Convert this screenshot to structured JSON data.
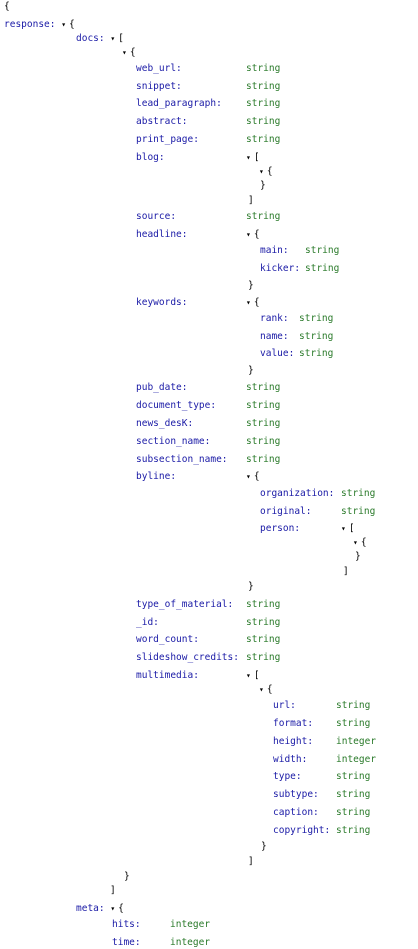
{
  "glyphs": {
    "toggle": "▾",
    "open_brace": "{",
    "close_brace": "}",
    "open_bracket": "[",
    "close_bracket": "]"
  },
  "tree": {
    "response_key": "response:",
    "docs_key": "docs:",
    "web_url_key": "web_url:",
    "snippet_key": "snippet:",
    "lead_paragraph_key": "lead_paragraph:",
    "abstract_key": "abstract:",
    "print_page_key": "print_page:",
    "blog_key": "blog:",
    "source_key": "source:",
    "headline_key": "headline:",
    "main_key": "main:",
    "kicker_key": "kicker:",
    "keywords_key": "keywords:",
    "rank_key": "rank:",
    "name_key": "name:",
    "value_key": "value:",
    "pub_date_key": "pub_date:",
    "document_type_key": "document_type:",
    "news_desk_key": "news_desK:",
    "section_name_key": "section_name:",
    "subsection_name_key": "subsection_name:",
    "byline_key": "byline:",
    "organization_key": "organization:",
    "original_key": "original:",
    "person_key": "person:",
    "type_of_material_key": "type_of_material:",
    "id_key": "_id:",
    "word_count_key": "word_count:",
    "slideshow_credits_key": "slideshow_credits:",
    "multimedia_key": "multimedia:",
    "url_key": "url:",
    "format_key": "format:",
    "height_key": "height:",
    "width_key": "width:",
    "type_key": "type:",
    "subtype_key": "subtype:",
    "caption_key": "caption:",
    "copyright_key": "copyright:",
    "meta_key": "meta:",
    "hits_key": "hits:",
    "time_key": "time:"
  },
  "types": {
    "string": "string",
    "integer": "integer"
  }
}
